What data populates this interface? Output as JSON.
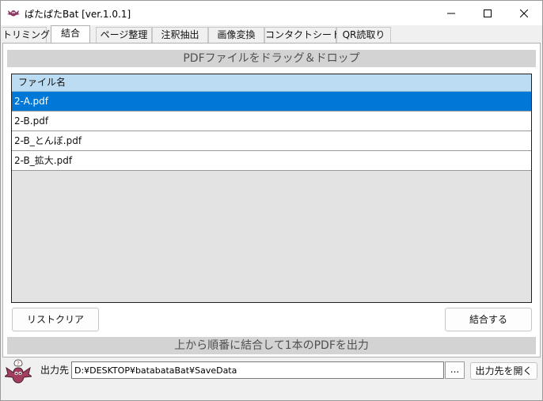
{
  "window": {
    "title": "ぱたぱたBat [ver.1.0.1]",
    "minimize_label": "Minimize",
    "maximize_label": "Maximize",
    "close_label": "Close"
  },
  "tabs": [
    {
      "label": "トリミング",
      "active": false
    },
    {
      "label": "結合",
      "active": true
    },
    {
      "label": "ページ整理",
      "active": false
    },
    {
      "label": "注釈抽出",
      "active": false
    },
    {
      "label": "画像変換",
      "active": false
    },
    {
      "label": "コンタクトシート",
      "active": false
    },
    {
      "label": "QR読取り",
      "active": false
    }
  ],
  "merge": {
    "drop_banner": "PDFファイルをドラッグ＆ドロップ",
    "list_header": "ファイル名",
    "files": [
      {
        "name": "2-A.pdf",
        "selected": true
      },
      {
        "name": "2-B.pdf",
        "selected": false
      },
      {
        "name": "2-B_とんぼ.pdf",
        "selected": false
      },
      {
        "name": "2-B_拡大.pdf",
        "selected": false
      }
    ],
    "clear_button": "リストクリア",
    "merge_button": "結合する",
    "description": "上から順番に結合して1本のPDFを出力"
  },
  "output": {
    "label": "出力先",
    "path": "D:¥DESKTOP¥batabataBat¥SaveData",
    "browse_label": "...",
    "open_button": "出力先を開く"
  },
  "colors": {
    "selection": "#0078d7",
    "header": "#bcdcf4",
    "banner": "#d3d3d3",
    "banner_text": "#505050"
  }
}
